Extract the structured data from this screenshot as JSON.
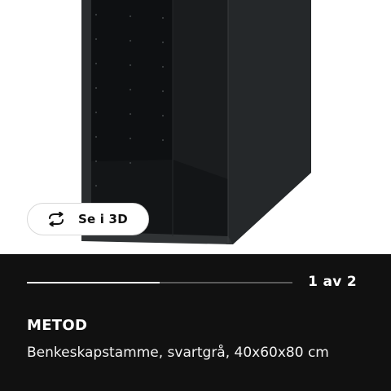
{
  "gallery": {
    "view_3d_label": "Se i 3D",
    "counter_text": "1 av 2",
    "progress_fraction": 0.5
  },
  "product": {
    "name": "METOD",
    "description": "Benkeskapstamme, svartgrå, 40x60x80 cm"
  },
  "colors": {
    "panel_background": "#111111",
    "cabinet": "#1f2224"
  },
  "icons": {
    "view_3d": "rotate-arrows-icon"
  }
}
